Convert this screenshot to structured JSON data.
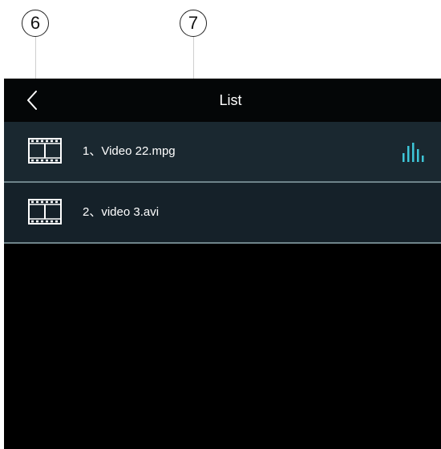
{
  "callouts": [
    {
      "number": "6"
    },
    {
      "number": "7"
    }
  ],
  "header": {
    "title": "List",
    "back_icon": "chevron-left-icon"
  },
  "files": [
    {
      "label": "1、Video 22.mpg",
      "icon": "film-icon",
      "playing": true
    },
    {
      "label": "2、video 3.avi",
      "icon": "film-icon",
      "playing": false
    }
  ],
  "colors": {
    "screen_bg": "#000000",
    "title_bar_bg": "#040607",
    "row_bg": "#152129",
    "row_divider": "#6f848a",
    "accent": "#3ec6d8",
    "text": "#ffffff"
  }
}
